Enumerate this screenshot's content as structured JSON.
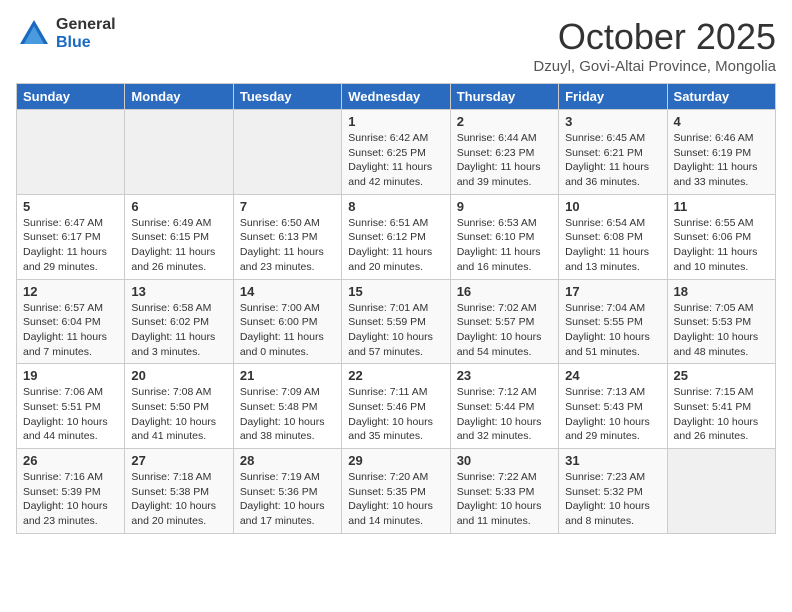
{
  "header": {
    "logo_general": "General",
    "logo_blue": "Blue",
    "month": "October 2025",
    "location": "Dzuyl, Govi-Altai Province, Mongolia"
  },
  "days_of_week": [
    "Sunday",
    "Monday",
    "Tuesday",
    "Wednesday",
    "Thursday",
    "Friday",
    "Saturday"
  ],
  "weeks": [
    [
      {
        "day": "",
        "info": ""
      },
      {
        "day": "",
        "info": ""
      },
      {
        "day": "",
        "info": ""
      },
      {
        "day": "1",
        "info": "Sunrise: 6:42 AM\nSunset: 6:25 PM\nDaylight: 11 hours\nand 42 minutes."
      },
      {
        "day": "2",
        "info": "Sunrise: 6:44 AM\nSunset: 6:23 PM\nDaylight: 11 hours\nand 39 minutes."
      },
      {
        "day": "3",
        "info": "Sunrise: 6:45 AM\nSunset: 6:21 PM\nDaylight: 11 hours\nand 36 minutes."
      },
      {
        "day": "4",
        "info": "Sunrise: 6:46 AM\nSunset: 6:19 PM\nDaylight: 11 hours\nand 33 minutes."
      }
    ],
    [
      {
        "day": "5",
        "info": "Sunrise: 6:47 AM\nSunset: 6:17 PM\nDaylight: 11 hours\nand 29 minutes."
      },
      {
        "day": "6",
        "info": "Sunrise: 6:49 AM\nSunset: 6:15 PM\nDaylight: 11 hours\nand 26 minutes."
      },
      {
        "day": "7",
        "info": "Sunrise: 6:50 AM\nSunset: 6:13 PM\nDaylight: 11 hours\nand 23 minutes."
      },
      {
        "day": "8",
        "info": "Sunrise: 6:51 AM\nSunset: 6:12 PM\nDaylight: 11 hours\nand 20 minutes."
      },
      {
        "day": "9",
        "info": "Sunrise: 6:53 AM\nSunset: 6:10 PM\nDaylight: 11 hours\nand 16 minutes."
      },
      {
        "day": "10",
        "info": "Sunrise: 6:54 AM\nSunset: 6:08 PM\nDaylight: 11 hours\nand 13 minutes."
      },
      {
        "day": "11",
        "info": "Sunrise: 6:55 AM\nSunset: 6:06 PM\nDaylight: 11 hours\nand 10 minutes."
      }
    ],
    [
      {
        "day": "12",
        "info": "Sunrise: 6:57 AM\nSunset: 6:04 PM\nDaylight: 11 hours\nand 7 minutes."
      },
      {
        "day": "13",
        "info": "Sunrise: 6:58 AM\nSunset: 6:02 PM\nDaylight: 11 hours\nand 3 minutes."
      },
      {
        "day": "14",
        "info": "Sunrise: 7:00 AM\nSunset: 6:00 PM\nDaylight: 11 hours\nand 0 minutes."
      },
      {
        "day": "15",
        "info": "Sunrise: 7:01 AM\nSunset: 5:59 PM\nDaylight: 10 hours\nand 57 minutes."
      },
      {
        "day": "16",
        "info": "Sunrise: 7:02 AM\nSunset: 5:57 PM\nDaylight: 10 hours\nand 54 minutes."
      },
      {
        "day": "17",
        "info": "Sunrise: 7:04 AM\nSunset: 5:55 PM\nDaylight: 10 hours\nand 51 minutes."
      },
      {
        "day": "18",
        "info": "Sunrise: 7:05 AM\nSunset: 5:53 PM\nDaylight: 10 hours\nand 48 minutes."
      }
    ],
    [
      {
        "day": "19",
        "info": "Sunrise: 7:06 AM\nSunset: 5:51 PM\nDaylight: 10 hours\nand 44 minutes."
      },
      {
        "day": "20",
        "info": "Sunrise: 7:08 AM\nSunset: 5:50 PM\nDaylight: 10 hours\nand 41 minutes."
      },
      {
        "day": "21",
        "info": "Sunrise: 7:09 AM\nSunset: 5:48 PM\nDaylight: 10 hours\nand 38 minutes."
      },
      {
        "day": "22",
        "info": "Sunrise: 7:11 AM\nSunset: 5:46 PM\nDaylight: 10 hours\nand 35 minutes."
      },
      {
        "day": "23",
        "info": "Sunrise: 7:12 AM\nSunset: 5:44 PM\nDaylight: 10 hours\nand 32 minutes."
      },
      {
        "day": "24",
        "info": "Sunrise: 7:13 AM\nSunset: 5:43 PM\nDaylight: 10 hours\nand 29 minutes."
      },
      {
        "day": "25",
        "info": "Sunrise: 7:15 AM\nSunset: 5:41 PM\nDaylight: 10 hours\nand 26 minutes."
      }
    ],
    [
      {
        "day": "26",
        "info": "Sunrise: 7:16 AM\nSunset: 5:39 PM\nDaylight: 10 hours\nand 23 minutes."
      },
      {
        "day": "27",
        "info": "Sunrise: 7:18 AM\nSunset: 5:38 PM\nDaylight: 10 hours\nand 20 minutes."
      },
      {
        "day": "28",
        "info": "Sunrise: 7:19 AM\nSunset: 5:36 PM\nDaylight: 10 hours\nand 17 minutes."
      },
      {
        "day": "29",
        "info": "Sunrise: 7:20 AM\nSunset: 5:35 PM\nDaylight: 10 hours\nand 14 minutes."
      },
      {
        "day": "30",
        "info": "Sunrise: 7:22 AM\nSunset: 5:33 PM\nDaylight: 10 hours\nand 11 minutes."
      },
      {
        "day": "31",
        "info": "Sunrise: 7:23 AM\nSunset: 5:32 PM\nDaylight: 10 hours\nand 8 minutes."
      },
      {
        "day": "",
        "info": ""
      }
    ]
  ]
}
